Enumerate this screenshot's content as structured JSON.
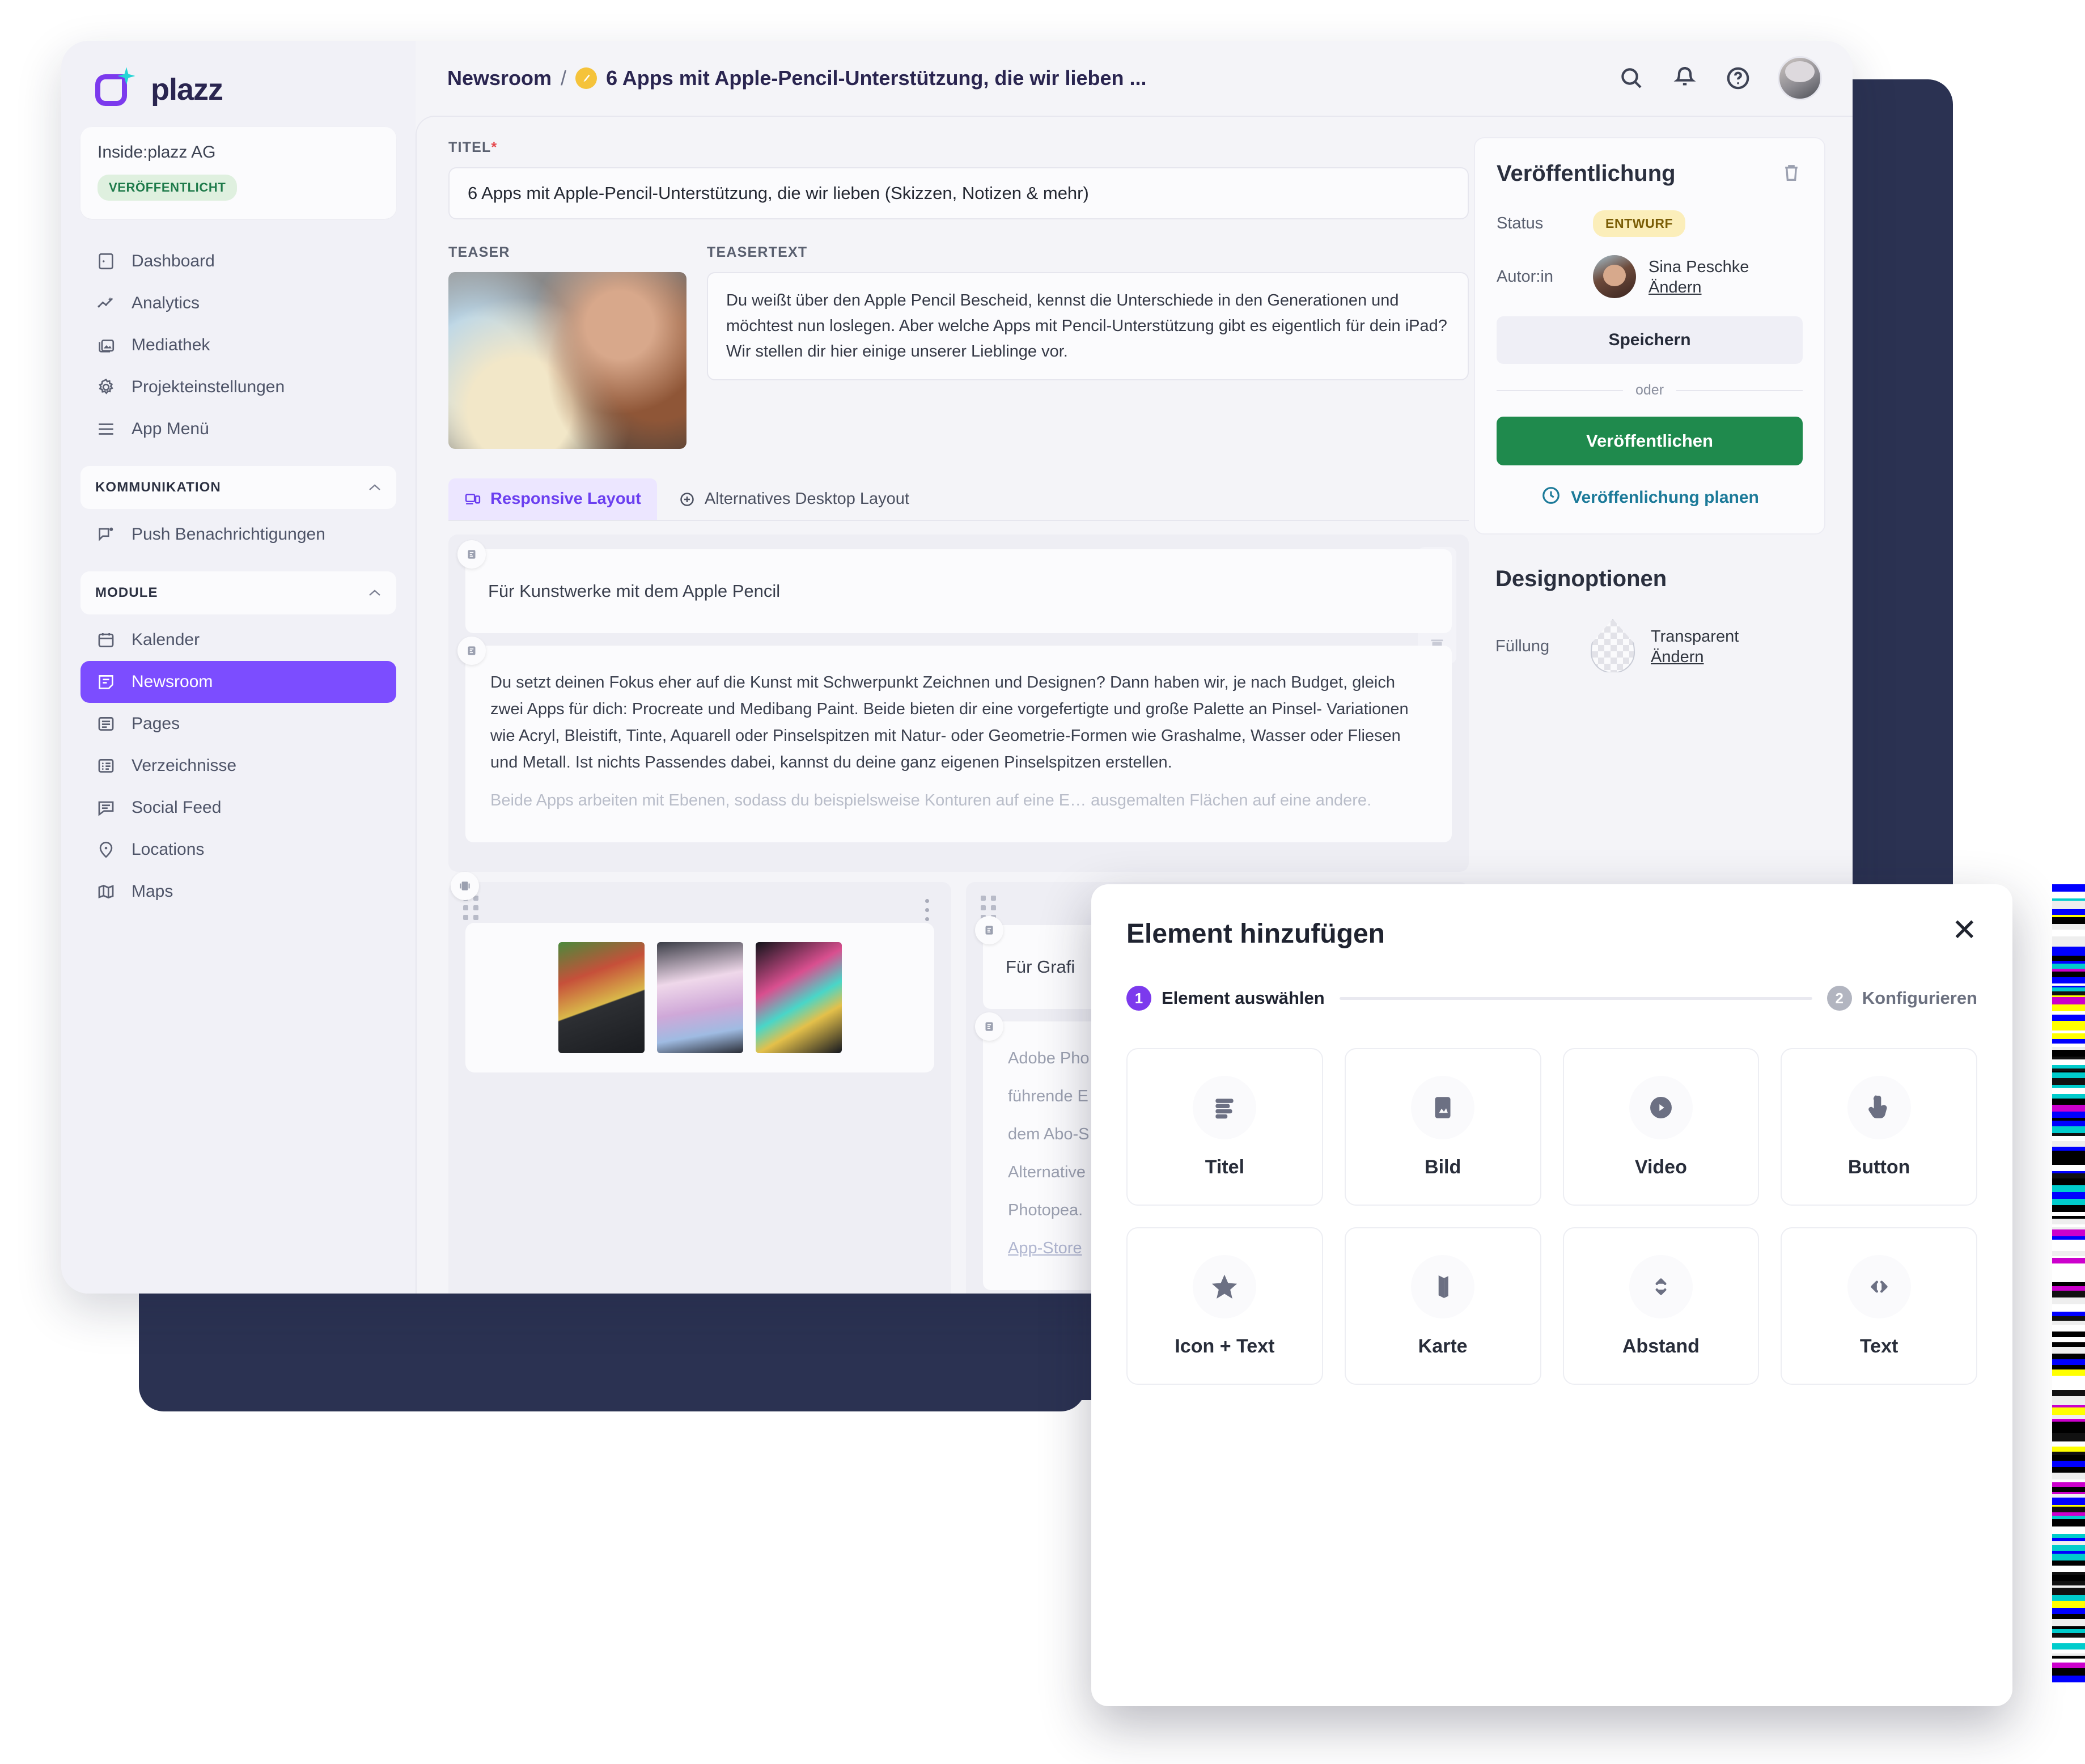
{
  "brand": {
    "name": "plazz",
    "logo_icon": "plazz-logo"
  },
  "org": {
    "name": "Inside:plazz AG",
    "status_badge": "VERÖFFENTLICHT"
  },
  "sidebar": {
    "items": [
      {
        "label": "Dashboard",
        "icon": "dashboard-icon"
      },
      {
        "label": "Analytics",
        "icon": "analytics-icon"
      },
      {
        "label": "Mediathek",
        "icon": "media-library-icon"
      },
      {
        "label": "Projekteinstellungen",
        "icon": "gear-icon"
      },
      {
        "label": "App Menü",
        "icon": "menu-icon"
      }
    ],
    "section_kommunikation": "KOMMUNIKATION",
    "kommunikation_items": [
      {
        "label": "Push Benachrichtigungen",
        "icon": "push-notification-icon"
      }
    ],
    "section_module": "MODULE",
    "module_items": [
      {
        "label": "Kalender",
        "icon": "calendar-icon",
        "active": false
      },
      {
        "label": "Newsroom",
        "icon": "newsroom-icon",
        "active": true
      },
      {
        "label": "Pages",
        "icon": "pages-icon",
        "active": false
      },
      {
        "label": "Verzeichnisse",
        "icon": "directory-icon",
        "active": false
      },
      {
        "label": "Social Feed",
        "icon": "social-feed-icon",
        "active": false
      },
      {
        "label": "Locations",
        "icon": "location-pin-icon",
        "active": false
      },
      {
        "label": "Maps",
        "icon": "map-icon",
        "active": false
      }
    ]
  },
  "header": {
    "breadcrumb_root": "Newsroom",
    "breadcrumb_separator": "/",
    "breadcrumb_current": "6 Apps mit Apple-Pencil-Unterstützung, die wir lieben ...",
    "icons": [
      "search-icon",
      "bell-icon",
      "help-circle-icon",
      "avatar"
    ]
  },
  "editor": {
    "title_label": "TITEL",
    "title_required_mark": "*",
    "title_value": "6 Apps mit Apple-Pencil-Unterstützung, die wir lieben (Skizzen, Notizen & mehr)",
    "teaser_label": "TEASER",
    "teasertext_label": "TEASERTEXT",
    "teasertext_value": "Du weißt über den Apple Pencil Bescheid, kennst die Unterschiede in den Generationen und möchtest nun loslegen. Aber welche Apps mit Pencil-Unterstützung gibt es eigentlich für dein iPad? Wir stellen dir hier einige unserer Lieblinge vor.",
    "tabs": [
      {
        "label": "Responsive Layout",
        "icon": "responsive-layout-icon",
        "active": true
      },
      {
        "label": "Alternatives Desktop Layout",
        "icon": "plus-circle-icon",
        "active": false
      }
    ],
    "blocks": {
      "heading_1": "Für Kunstwerke mit dem Apple Pencil",
      "para_1": "Du setzt deinen Fokus eher auf die Kunst mit Schwerpunkt Zeichnen und Designen? Dann haben wir, je nach Budget, gleich zwei Apps für dich: Procreate und Medibang Paint. Beide bieten dir eine vorgefertigte und große Palette an Pinsel- Variationen wie Acryl, Bleistift, Tinte, Aquarell oder Pinselspitzen mit Natur- oder Geometrie-Formen wie Grashalme, Wasser oder Fliesen und Metall. Ist nichts Passendes dabei, kannst du deine ganz eigenen Pinselspitzen erstellen.",
      "para_1_faded": "Beide Apps arbeiten mit Ebenen, sodass du beispielsweise Konturen auf eine E… ausgemalten Flächen auf eine andere.",
      "heading_2": "Für Grafi",
      "para_2_lines": [
        "Adobe Pho",
        "führende E",
        "dem Abo-S",
        "Alternative",
        "Photopea.",
        "App-Store"
      ]
    }
  },
  "publish_panel": {
    "title": "Veröffentlichung",
    "delete_icon": "trash-icon",
    "status_label": "Status",
    "status_value": "ENTWURF",
    "author_label": "Autor:in",
    "author_name": "Sina Peschke",
    "author_change_link": "Ändern",
    "save_button": "Speichern",
    "or_text": "oder",
    "publish_button": "Veröffentlichen",
    "schedule_link": "Veröffenlichung planen",
    "schedule_icon": "clock-icon",
    "accent_green": "#1f8a4d",
    "accent_teal": "#1c7a99"
  },
  "design_panel": {
    "title": "Designoptionen",
    "fill_label": "Füllung",
    "fill_value": "Transparent",
    "fill_change_link": "Ändern"
  },
  "modal": {
    "title": "Element hinzufügen",
    "close_icon": "close-icon",
    "steps": [
      {
        "number": "1",
        "label": "Element auswählen",
        "active": true
      },
      {
        "number": "2",
        "label": "Konfigurieren",
        "active": false
      }
    ],
    "cards": [
      {
        "label": "Titel",
        "icon": "text-lines-icon"
      },
      {
        "label": "Bild",
        "icon": "image-icon"
      },
      {
        "label": "Video",
        "icon": "play-circle-icon"
      },
      {
        "label": "Button",
        "icon": "tap-hand-icon"
      },
      {
        "label": "Icon + Text",
        "icon": "star-icon"
      },
      {
        "label": "Karte",
        "icon": "map-folded-icon"
      },
      {
        "label": "Abstand",
        "icon": "spacing-arrows-icon"
      },
      {
        "label": "Text",
        "icon": "code-brackets-icon"
      }
    ]
  },
  "colors": {
    "brand_purple": "#7c3aed",
    "active_nav": "#7c4dff",
    "publish_green": "#1f8a4d",
    "draft_yellow": "#fbeeba",
    "published_green": "#dff0df",
    "dark_backdrop": "#2b3252"
  }
}
